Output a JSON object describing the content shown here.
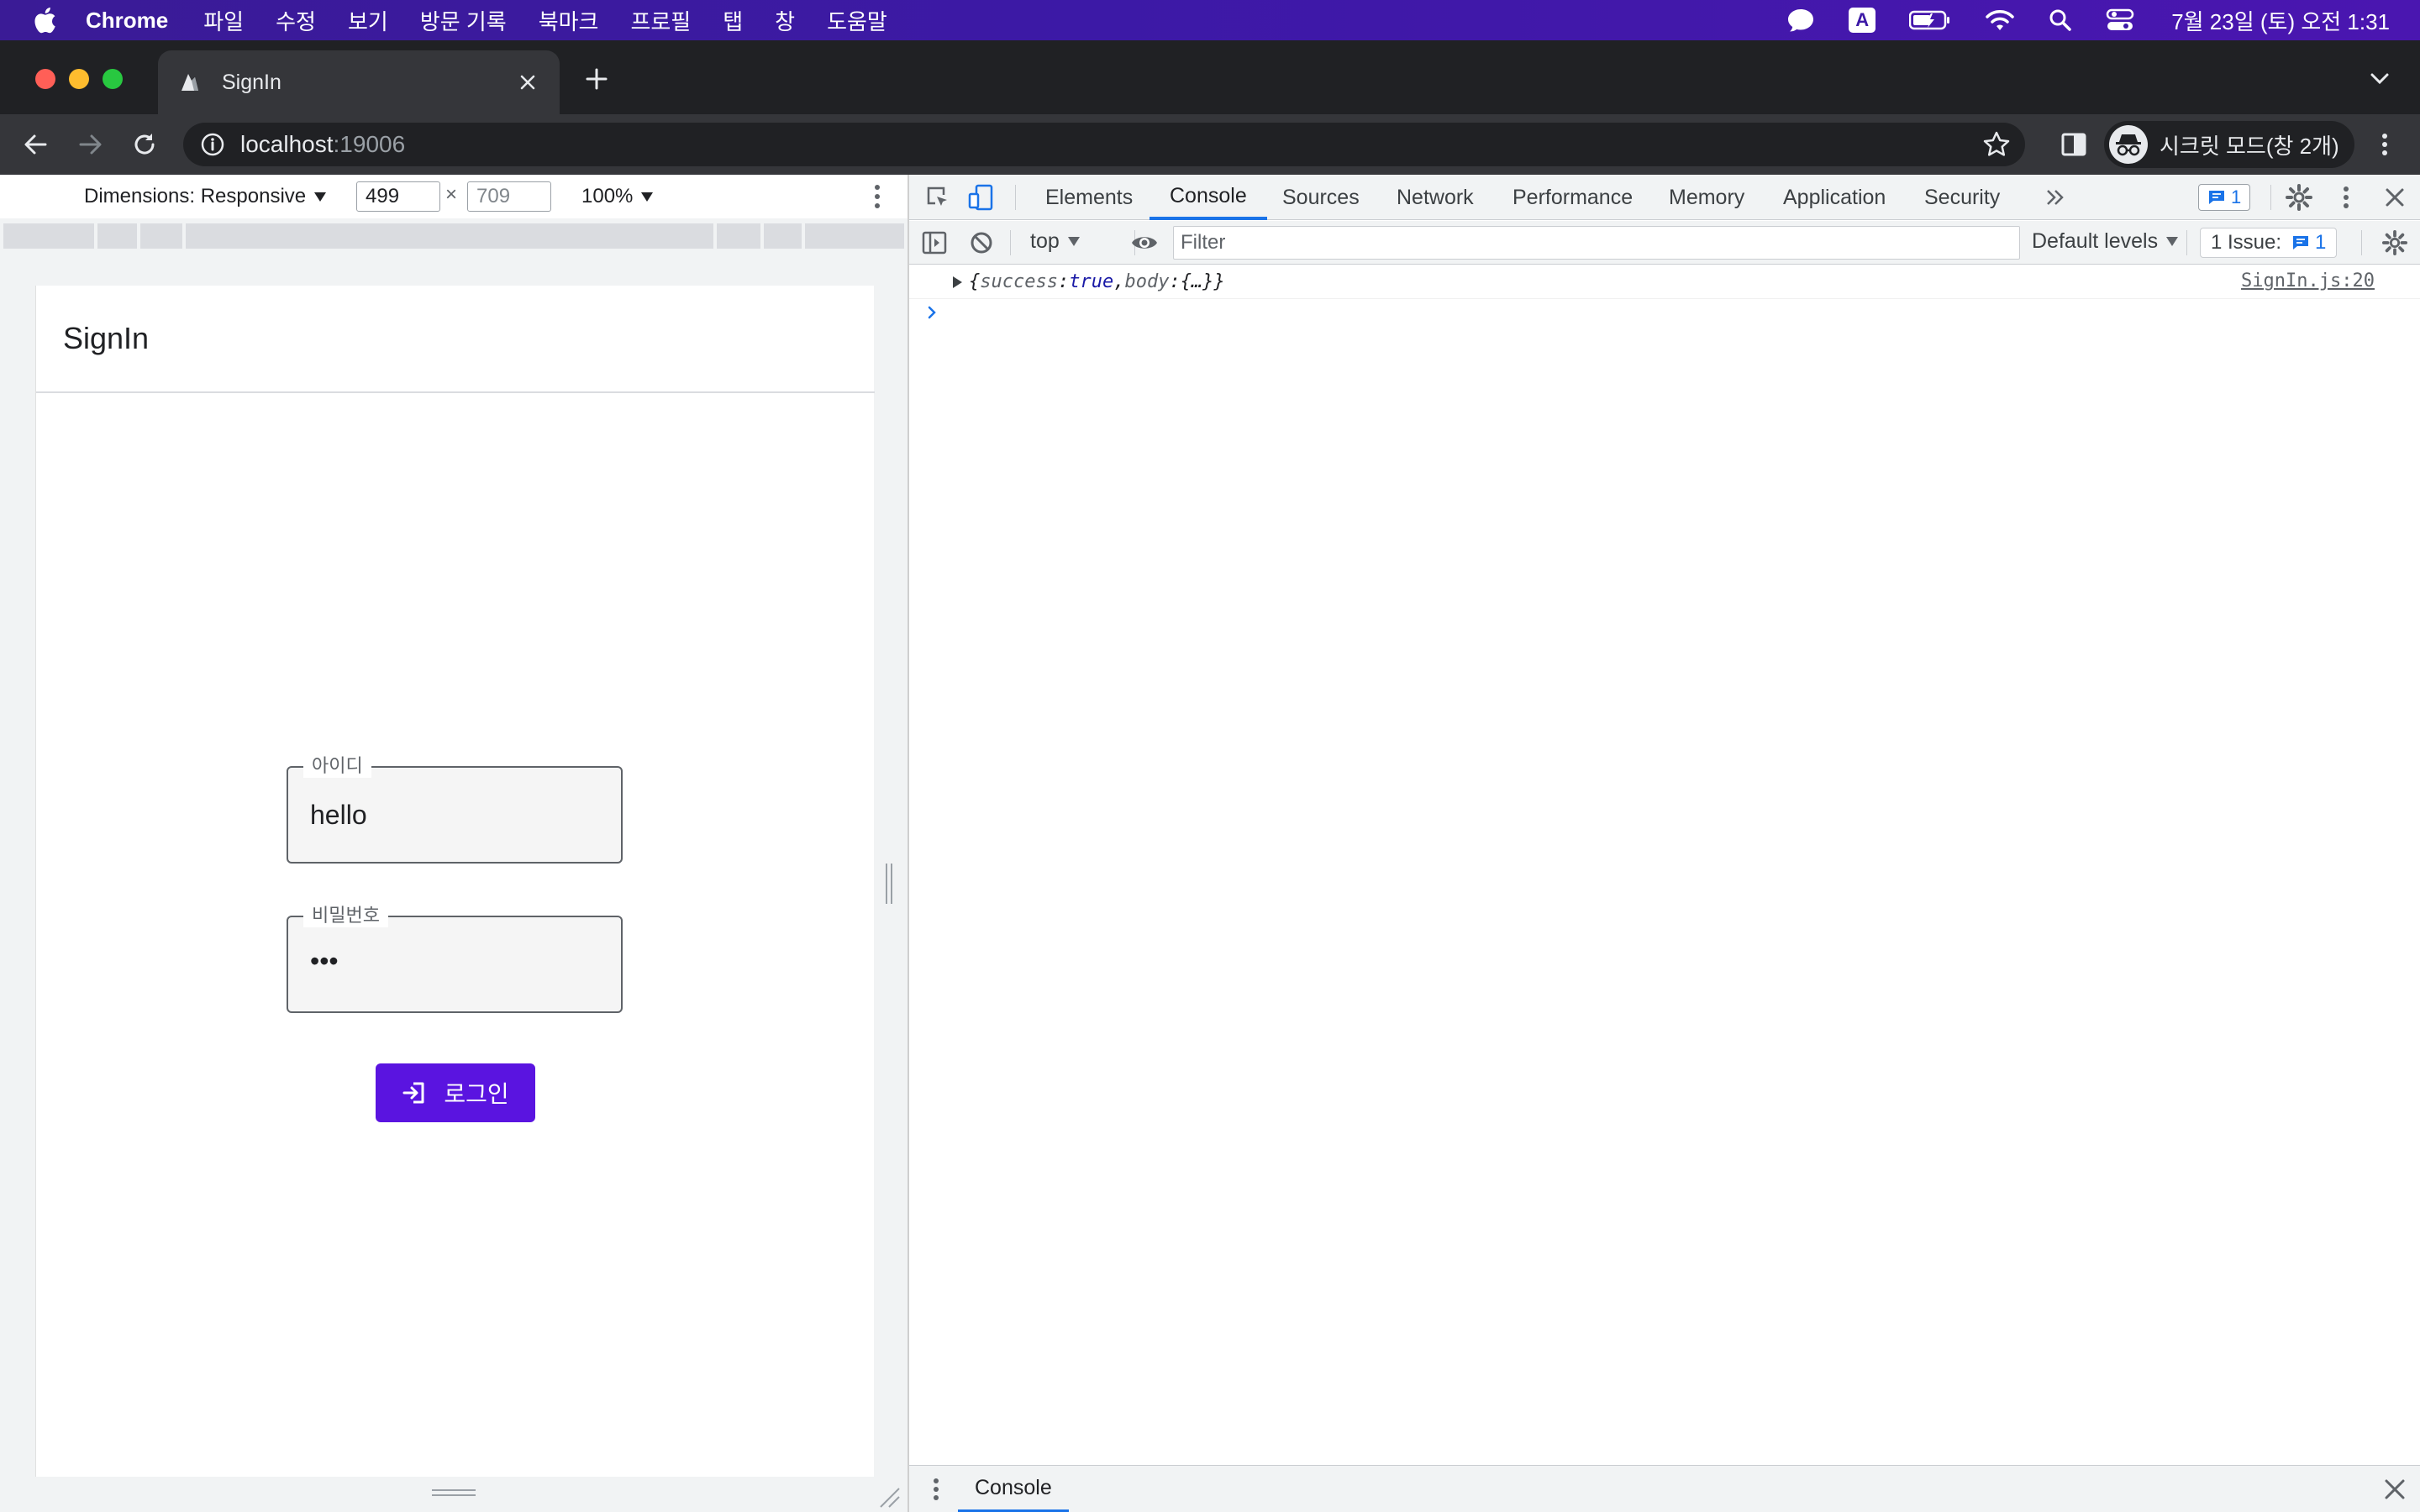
{
  "menubar": {
    "app": "Chrome",
    "items": [
      "파일",
      "수정",
      "보기",
      "방문 기록",
      "북마크",
      "프로필",
      "탭",
      "창",
      "도움말"
    ],
    "input_indicator": "A",
    "clock": "7월 23일 (토) 오전 1:31"
  },
  "browser": {
    "tab_title": "SignIn",
    "url_host": "localhost",
    "url_port": ":19006",
    "incognito_label": "시크릿 모드(창 2개)"
  },
  "device_toolbar": {
    "dimensions_label": "Dimensions: Responsive",
    "width": "499",
    "height": "709",
    "times": "×",
    "zoom": "100%"
  },
  "app": {
    "header_title": "SignIn",
    "id_label": "아이디",
    "id_value": "hello",
    "pw_label": "비밀번호",
    "pw_value": "•••",
    "login_label": "로그인"
  },
  "devtools": {
    "tabs": [
      "Elements",
      "Console",
      "Sources",
      "Network",
      "Performance",
      "Memory",
      "Application",
      "Security"
    ],
    "active_tab": "Console",
    "message_badge": "1",
    "context": "top",
    "filter_placeholder": "Filter",
    "levels": "Default levels",
    "issues_label": "1 Issue:",
    "issues_count": "1",
    "log": {
      "open": "{",
      "k1": "success",
      "colon": ": ",
      "v1": "true",
      "comma": ", ",
      "k2": "body",
      "v2": "{…}",
      "close": "}",
      "source": "SignIn.js:20"
    },
    "drawer_tab": "Console"
  },
  "colors": {
    "accent": "#5a14e0",
    "devtools_blue": "#1a73e8",
    "menubar": "#3c19a6"
  }
}
